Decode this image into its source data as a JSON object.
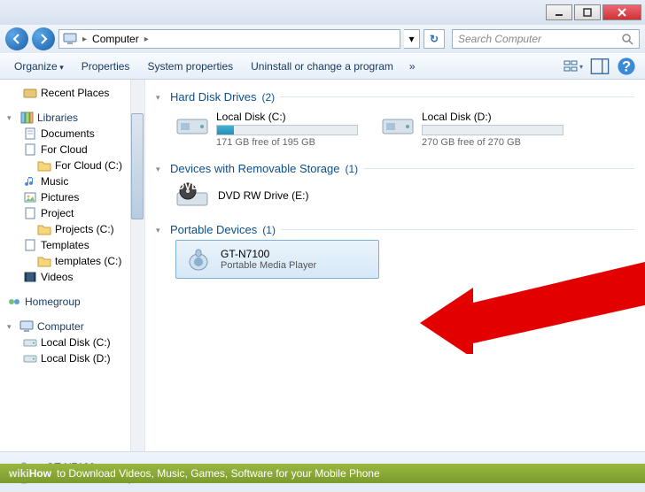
{
  "titlebar": {},
  "nav": {
    "breadcrumb_root": "Computer",
    "search_placeholder": "Search Computer"
  },
  "toolbar": {
    "organize": "Organize",
    "properties": "Properties",
    "system_properties": "System properties",
    "uninstall": "Uninstall or change a program"
  },
  "sidebar": {
    "recent_places": "Recent Places",
    "libraries": "Libraries",
    "documents": "Documents",
    "for_cloud": "For Cloud",
    "for_cloud_c": "For Cloud (C:)",
    "music": "Music",
    "pictures": "Pictures",
    "project": "Project",
    "projects_c": "Projects (C:)",
    "templates": "Templates",
    "templates_c": "templates (C:)",
    "videos": "Videos",
    "homegroup": "Homegroup",
    "computer": "Computer",
    "local_c": "Local Disk (C:)",
    "local_d": "Local Disk (D:)"
  },
  "content": {
    "hdd_label": "Hard Disk Drives",
    "hdd_count": "(2)",
    "drives": [
      {
        "name": "Local Disk (C:)",
        "free_text": "171 GB free of 195 GB",
        "fill_pct": 12
      },
      {
        "name": "Local Disk (D:)",
        "free_text": "270 GB free of 270 GB",
        "fill_pct": 0
      }
    ],
    "removable_label": "Devices with Removable Storage",
    "removable_count": "(1)",
    "dvd_name": "DVD RW Drive (E:)",
    "portable_label": "Portable Devices",
    "portable_count": "(1)",
    "portable_name": "GT-N7100",
    "portable_sub": "Portable Media Player"
  },
  "details": {
    "name": "GT-N7100",
    "sub": "Portable Media Player"
  },
  "banner": {
    "brand_gray": "wiki",
    "brand_white": "How",
    "title": " to Download Videos, Music, Games, Software for your Mobile Phone"
  }
}
